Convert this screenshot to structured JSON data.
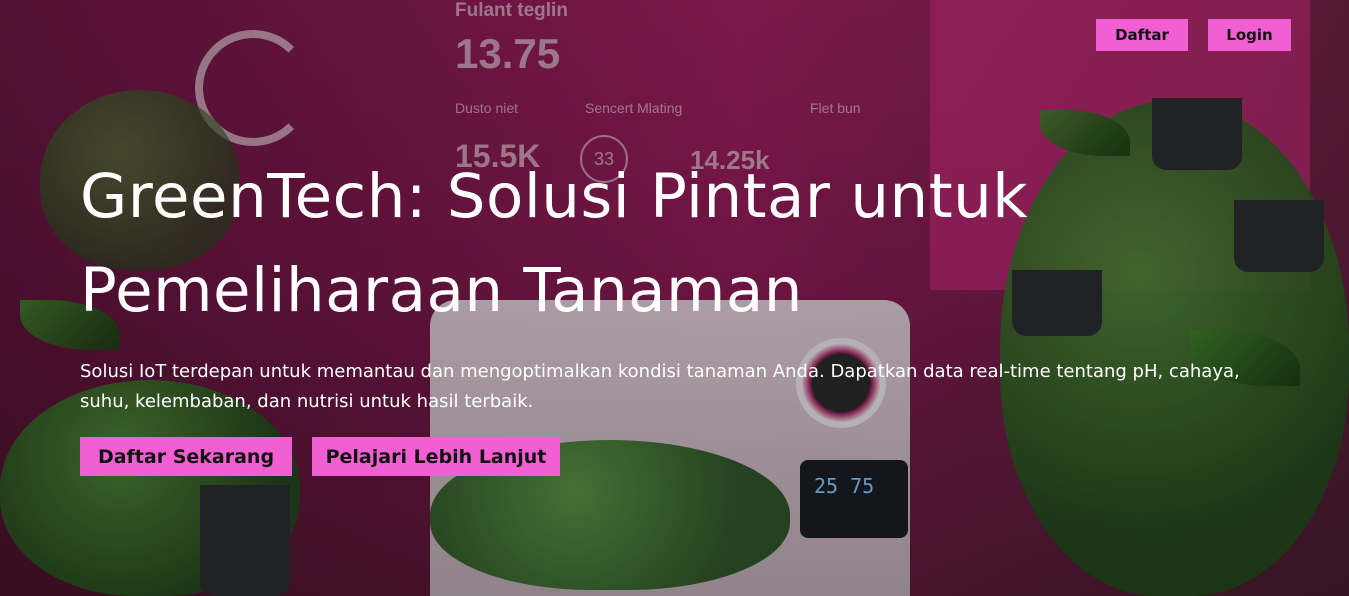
{
  "nav": {
    "register_label": "Daftar",
    "login_label": "Login"
  },
  "hero": {
    "title_line1": "GreenTech: Solusi Pintar untuk",
    "title_line2": "Pemeliharaan Tanaman",
    "description": "Solusi IoT terdepan untuk memantau dan mengoptimalkan kondisi tanaman Anda. Dapatkan data real-time tentang pH, cahaya, suhu, kelembaban, dan nutrisi untuk hasil terbaik.",
    "cta_primary": "Daftar Sekarang",
    "cta_secondary": "Pelajari Lebih Lanjut"
  },
  "background_image": {
    "dashboard_title": "Fulant teglin",
    "main_value": "13.75",
    "stat1_label": "Dusto niet",
    "stat1_value": "15.5K",
    "stat2_label": "Sencert Mlating",
    "stat2_badge": "33",
    "stat2_value": "14.25k",
    "stat3_label": "Flet bun",
    "device_readout": "25 75"
  },
  "colors": {
    "button_bg": "#f25fd3",
    "button_text": "#111111",
    "hero_text": "#ffffff",
    "background_tint": "#b8246e"
  }
}
